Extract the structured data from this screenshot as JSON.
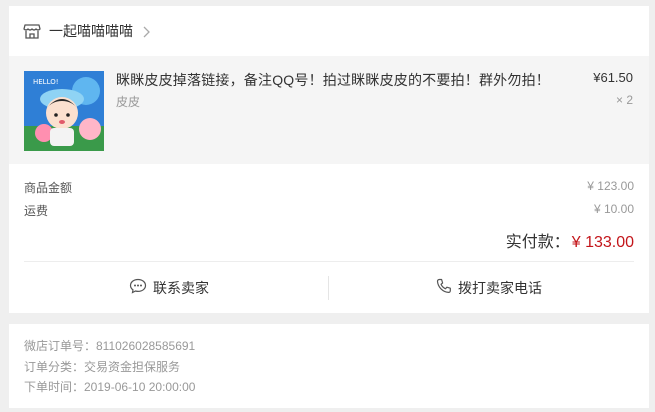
{
  "shop": {
    "name": "一起喵喵喵喵",
    "icon": "store-icon",
    "chevron_icon": "chevron-right-icon"
  },
  "product": {
    "title": "眯眯皮皮掉落链接，备注QQ号！拍过眯眯皮皮的不要拍！群外勿拍！",
    "sku": "皮皮",
    "price": "¥61.50",
    "quantity": "× 2",
    "thumbnail_text": "HELLO!"
  },
  "amounts": {
    "goods_label": "商品金额",
    "goods_value": "¥ 123.00",
    "shipping_label": "运费",
    "shipping_value": "¥ 10.00",
    "total_label": "实付款：",
    "total_value": "¥ 133.00"
  },
  "actions": {
    "contact_seller": "联系卖家",
    "contact_icon": "chat-bubble-icon",
    "call_seller": "拨打卖家电话",
    "call_icon": "phone-icon"
  },
  "order_info": {
    "order_no": "微店订单号：811026028585691",
    "category": "订单分类：交易资金担保服务",
    "created_time": "下单时间：2019-06-10 20:00:00"
  },
  "colors": {
    "accent_red": "#c3151a",
    "background": "#efefef"
  }
}
